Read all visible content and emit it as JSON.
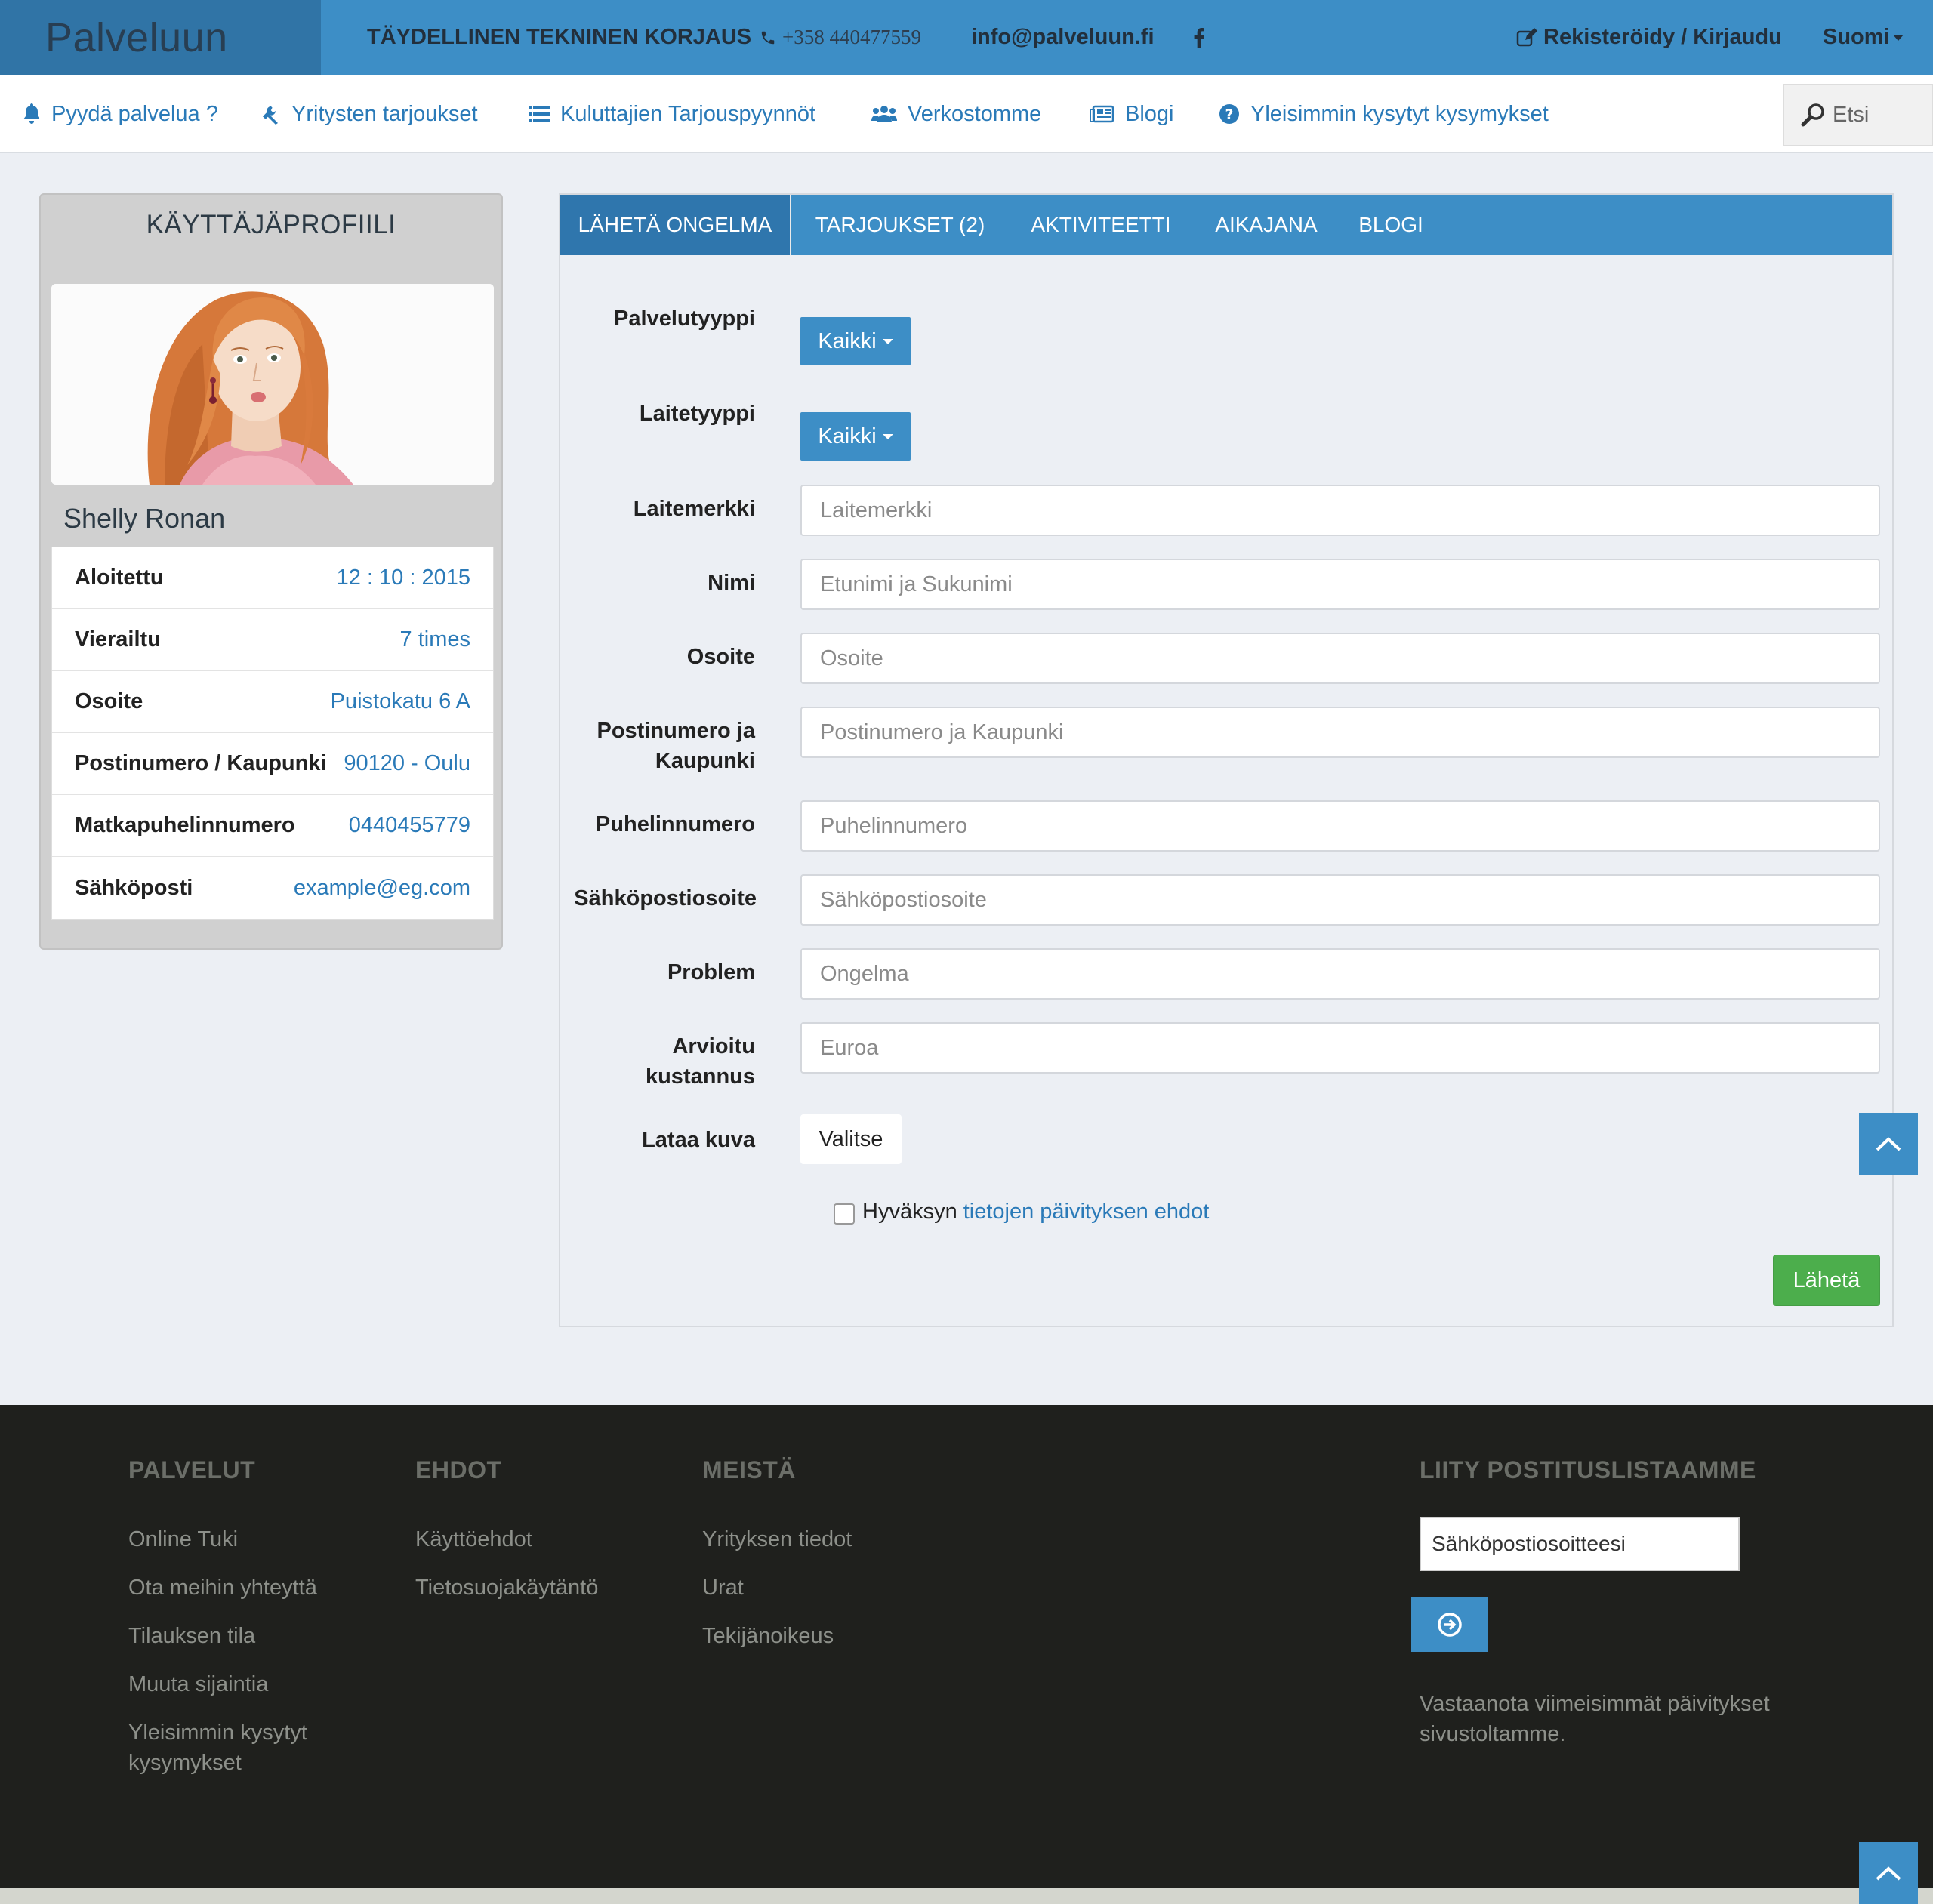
{
  "header": {
    "logo": "Palveluun",
    "tagline": "TÄYDELLINEN TEKNINEN KORJAUS",
    "phone": "+358 440477559",
    "email": "info@palveluun.fi",
    "facebook_icon": "facebook-icon",
    "register_login": "Rekisteröidy / Kirjaudu",
    "language": "Suomi"
  },
  "nav": {
    "items": [
      {
        "label": "Pyydä palvelua ?",
        "icon": "bell-icon"
      },
      {
        "label": "Yritysten tarjoukset",
        "icon": "wrench-icon"
      },
      {
        "label": "Kuluttajien Tarjouspyynnöt",
        "icon": "list-icon"
      },
      {
        "label": "Verkostomme",
        "icon": "users-icon"
      },
      {
        "label": "Blogi",
        "icon": "newspaper-icon"
      },
      {
        "label": "Yleisimmin kysytyt kysymykset",
        "icon": "question-circle-icon"
      }
    ],
    "search_placeholder": "Etsi"
  },
  "profile": {
    "title": "KÄYTTÄJÄPROFIILI",
    "name": "Shelly Ronan",
    "rows": [
      {
        "label": "Aloitettu",
        "value": "12 : 10 : 2015"
      },
      {
        "label": "Vierailtu",
        "value": "7 times"
      },
      {
        "label": "Osoite",
        "value": "Puistokatu 6 A"
      },
      {
        "label": "Postinumero / Kaupunki",
        "value": "90120 - Oulu"
      },
      {
        "label": "Matkapuhelinnumero",
        "value": "0440455779"
      },
      {
        "label": "Sähköposti",
        "value": "example@eg.com"
      }
    ]
  },
  "tabs": [
    {
      "label": "LÄHETÄ ONGELMA",
      "active": true
    },
    {
      "label": "TARJOUKSET (2)",
      "active": false
    },
    {
      "label": "AKTIVITEETTI",
      "active": false
    },
    {
      "label": "AIKAJANA",
      "active": false
    },
    {
      "label": "BLOGI",
      "active": false
    }
  ],
  "form": {
    "service_type_label": "Palvelutyyppi",
    "service_type_value": "Kaikki",
    "device_type_label": "Laitetyyppi",
    "device_type_value": "Kaikki",
    "brand_label": "Laitemerkki",
    "brand_placeholder": "Laitemerkki",
    "name_label": "Nimi",
    "name_placeholder": "Etunimi ja Sukunimi",
    "address_label": "Osoite",
    "address_placeholder": "Osoite",
    "postal_label_1": "Postinumero ja",
    "postal_label_2": "Kaupunki",
    "postal_placeholder": "Postinumero ja Kaupunki",
    "phone_label": "Puhelinnumero",
    "phone_placeholder": "Puhelinnumero",
    "email_label": "Sähköpostiosoite",
    "email_placeholder": "Sähköpostiosoite",
    "problem_label": "Problem",
    "problem_placeholder": "Ongelma",
    "cost_label_1": "Arvioitu",
    "cost_label_2": "kustannus",
    "cost_placeholder": "Euroa",
    "upload_label": "Lataa kuva",
    "upload_button": "Valitse",
    "consent_text": "Hyväksyn",
    "consent_link": "tietojen päivityksen ehdot",
    "submit": "Lähetä"
  },
  "footer": {
    "columns": [
      {
        "title": "PALVELUT",
        "links": [
          "Online Tuki",
          "Ota meihin yhteyttä",
          "Tilauksen tila",
          "Muuta sijaintia",
          "Yleisimmin kysytyt",
          "kysymykset"
        ]
      },
      {
        "title": "EHDOT",
        "links": [
          "Käyttöehdot",
          "Tietosuojakäytäntö"
        ]
      },
      {
        "title": "MEISTÄ",
        "links": [
          "Yrityksen tiedot",
          "Urat",
          "Tekijänoikeus"
        ]
      }
    ],
    "newsletter": {
      "title": "LIITY POSTITUSLISTAAMME",
      "placeholder": "Sähköpostiosoitteesi",
      "text_1": "Vastaanota viimeisimmät päivitykset",
      "text_2": "sivustoltamme."
    }
  },
  "colors": {
    "brand_blue": "#3d8ec6",
    "dark_blue": "#3074a6",
    "link_blue": "#2a7ab8",
    "success_green": "#4cae4c",
    "footer_bg": "#1f201d"
  }
}
